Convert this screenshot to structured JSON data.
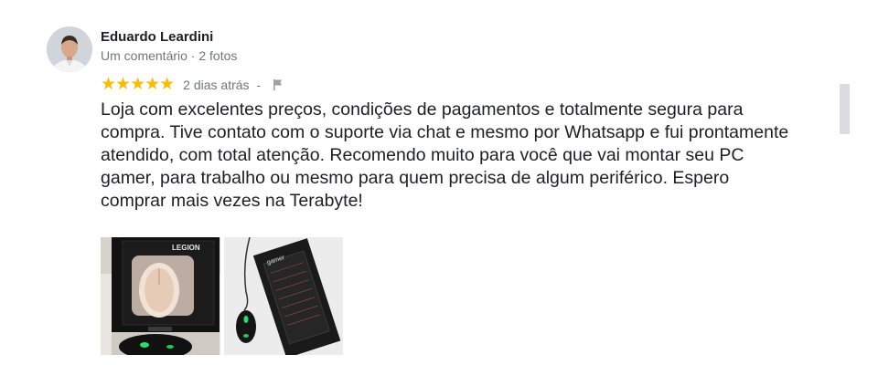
{
  "review": {
    "author": "Eduardo Leardini",
    "meta": "Um comentário · 2 fotos",
    "stars": "★★★★★",
    "rating_value": 5,
    "date": "2 dias atrás",
    "separator": "-",
    "text": "Loja com excelentes preços, condições de pagamentos e totalmente segura para compra. Tive contato com o suporte via chat e mesmo por Whatsapp e fui prontamente atendido, com total atenção. Recomendo muito para você que vai montar seu PC gamer, para trabalho ou mesmo para quem precisa de algum periférico. Espero comprar mais vezes na Terabyte!",
    "photos": [
      {
        "icon": "mouse-box-photo",
        "box_brand": "LEGION"
      },
      {
        "icon": "keyboard-box-photo",
        "box_brand": "gamer"
      }
    ]
  },
  "colors": {
    "star": "#fbbc04",
    "text_primary": "#202124",
    "text_secondary": "#70757a",
    "scrollbar": "#dadce0"
  },
  "icons": {
    "flag": "flag-icon",
    "avatar": "avatar"
  }
}
